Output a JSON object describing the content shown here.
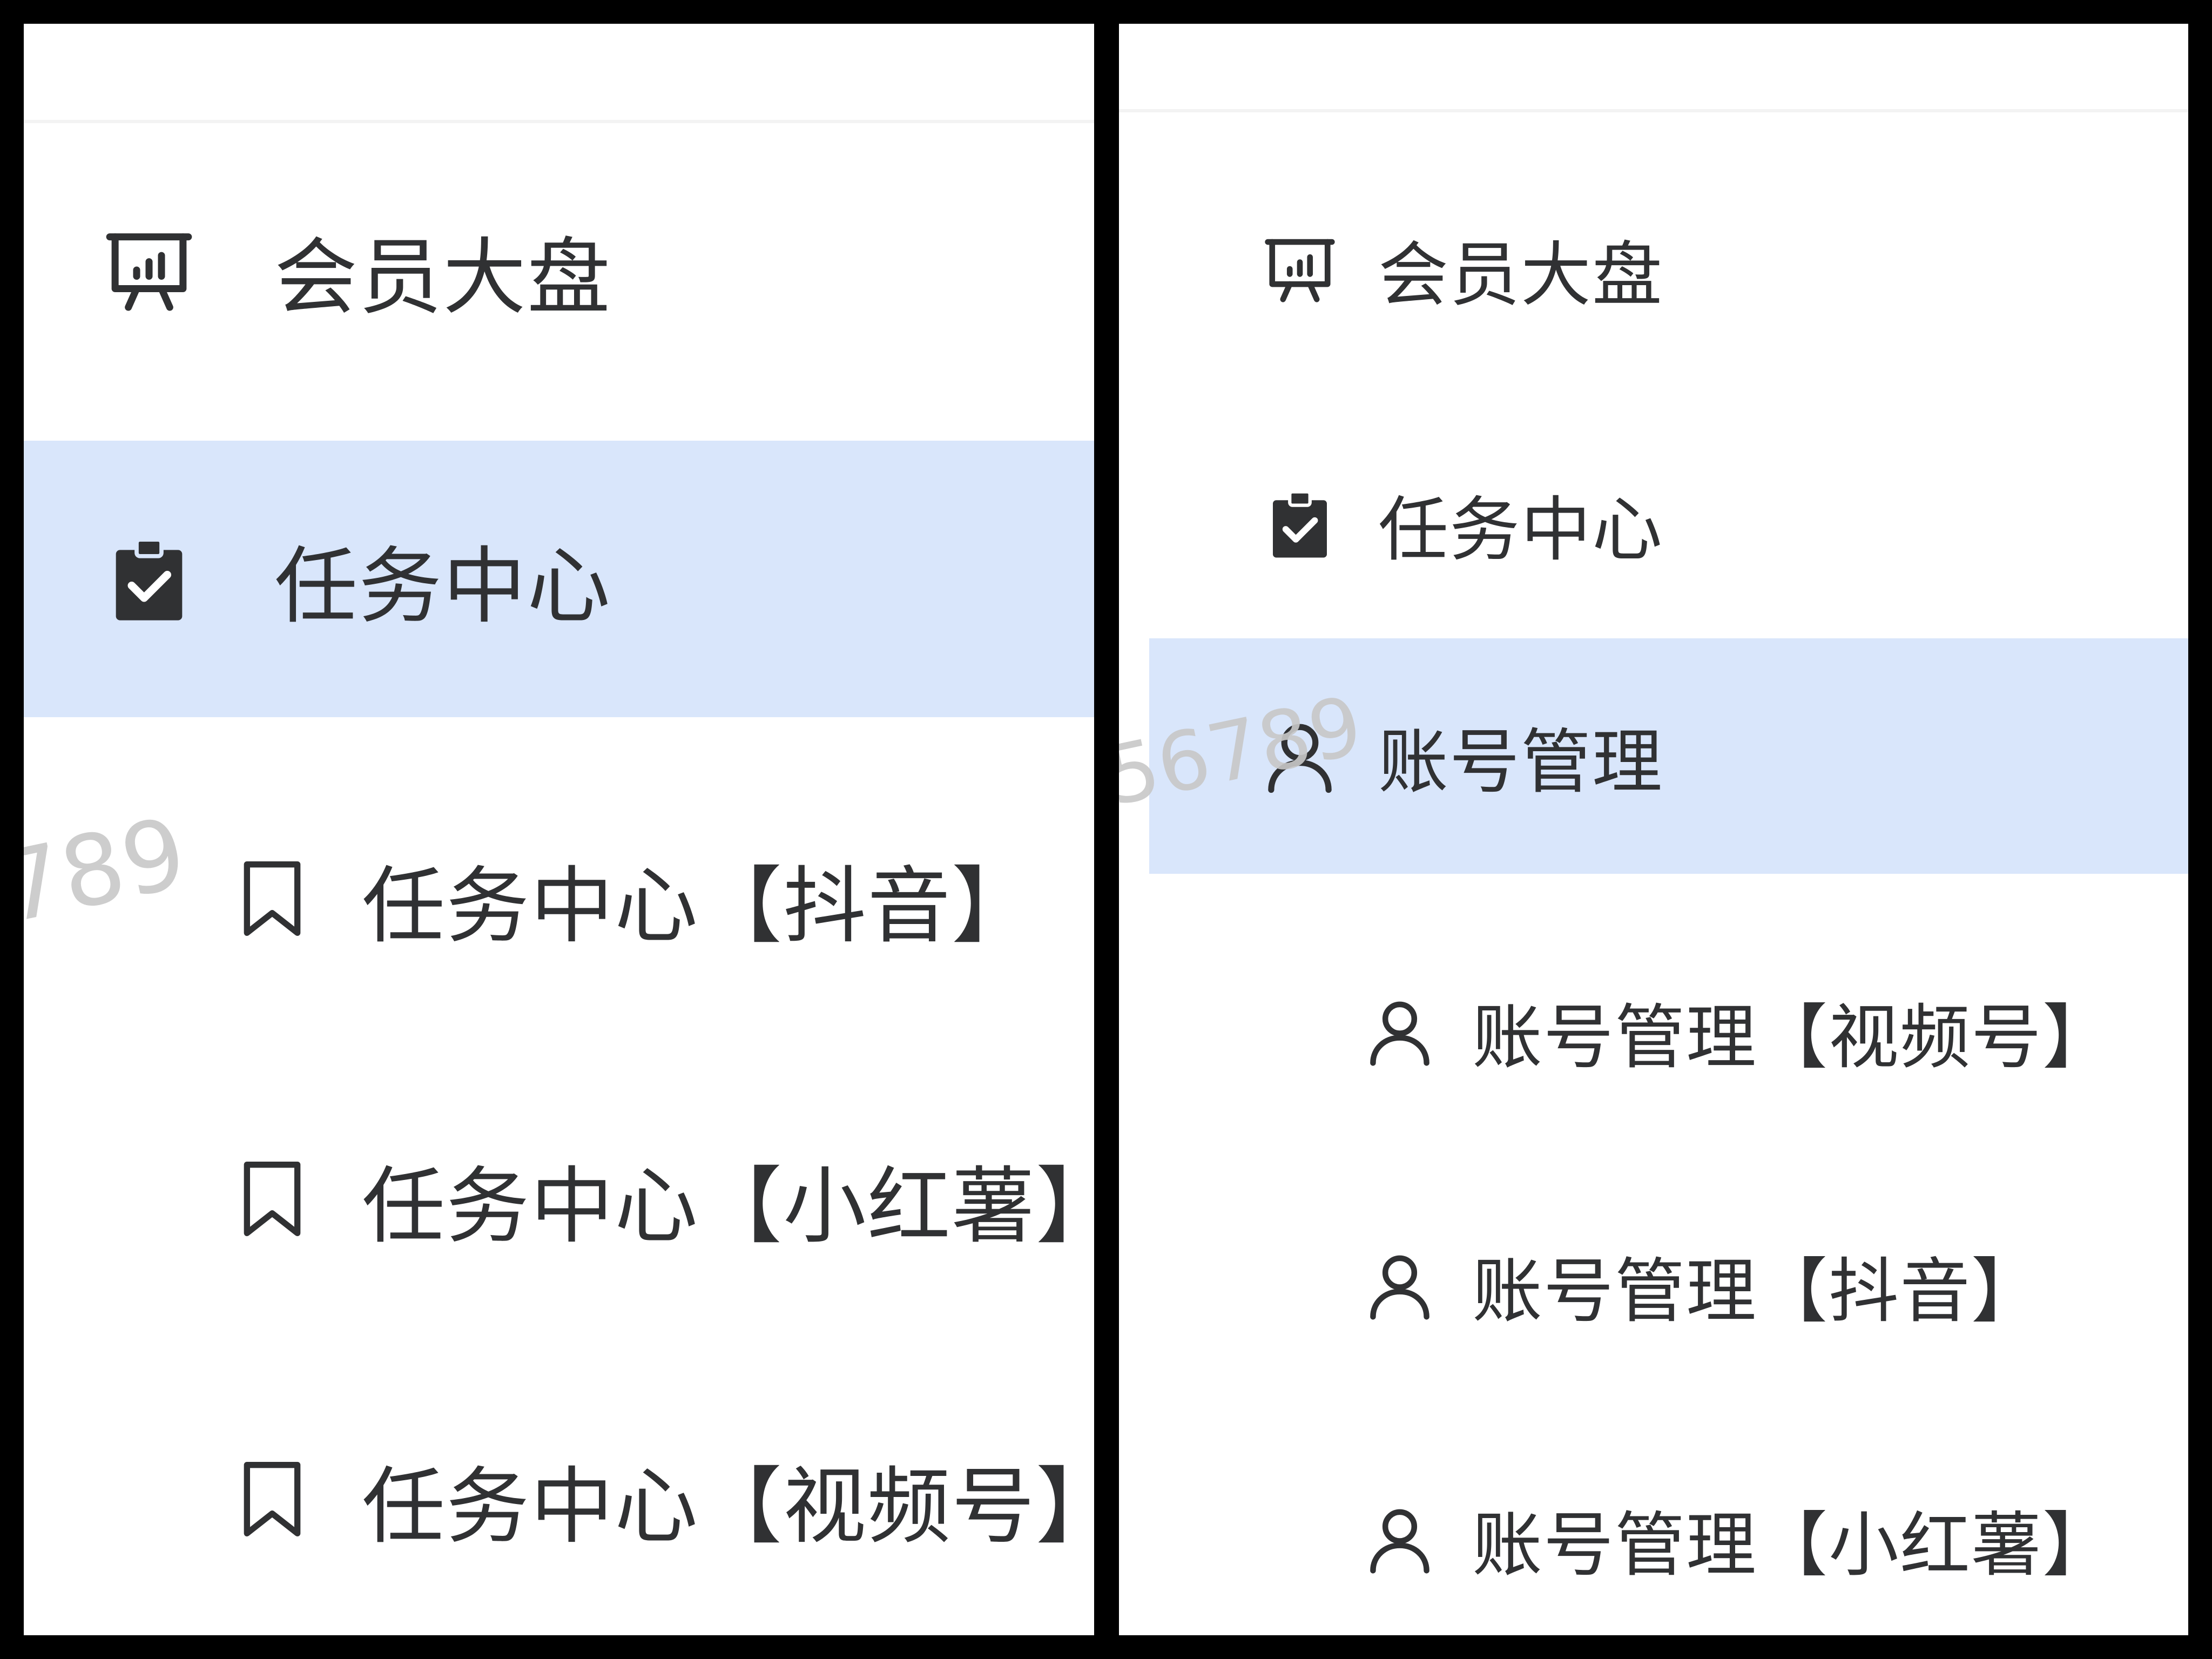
{
  "left_panel": {
    "menu": [
      {
        "label": "会员大盘",
        "icon": "presentation-board-icon",
        "active": false
      },
      {
        "label": "任务中心",
        "icon": "clipboard-check-icon",
        "active": true
      },
      {
        "label": "任务中心【抖音】",
        "icon": "bookmark-icon",
        "active": false
      },
      {
        "label": "任务中心【小红薯】",
        "icon": "bookmark-icon",
        "active": false
      },
      {
        "label": "任务中心【视频号】",
        "icon": "bookmark-icon",
        "active": false
      }
    ],
    "watermark": "789"
  },
  "right_panel": {
    "menu": [
      {
        "label": "会员大盘",
        "icon": "presentation-board-icon",
        "active": false
      },
      {
        "label": "任务中心",
        "icon": "clipboard-check-icon",
        "active": false
      },
      {
        "label": "账号管理",
        "icon": "user-icon",
        "active": true
      },
      {
        "label": "账号管理【视频号】",
        "icon": "user-icon",
        "active": false
      },
      {
        "label": "账号管理【抖音】",
        "icon": "user-icon",
        "active": false
      },
      {
        "label": "账号管理【小红薯】",
        "icon": "user-icon",
        "active": false
      }
    ],
    "watermark": "56789"
  },
  "colors": {
    "active_background": "#d9e6fb",
    "text": "#303133",
    "icon": "#303133",
    "frame": "#000000",
    "watermark": "#c8c8c8"
  }
}
